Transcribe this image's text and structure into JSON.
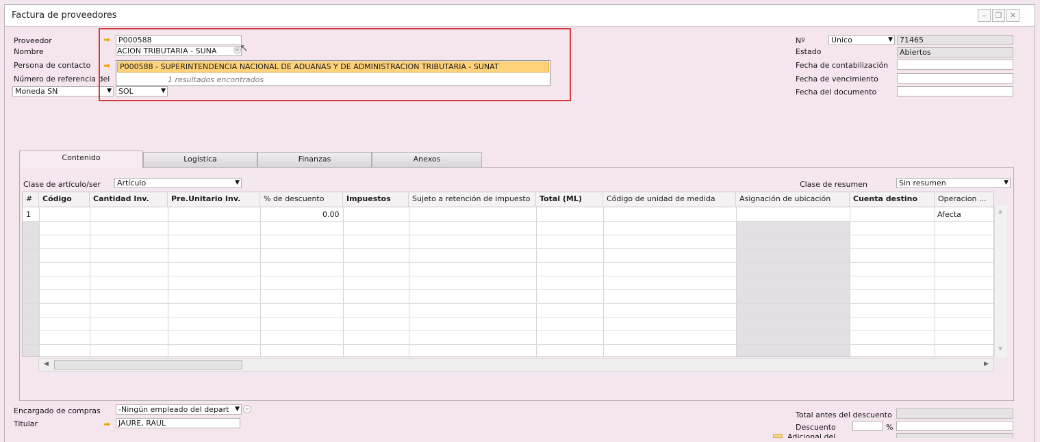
{
  "window": {
    "title": "Factura de proveedores"
  },
  "header": {
    "proveedor_label": "Proveedor",
    "proveedor_value": "P000588",
    "nombre_label": "Nombre",
    "nombre_value": "ACION TRIBUTARIA - SUNA",
    "contacto_label": "Persona de contacto",
    "referencia_label": "Número de referencia del",
    "moneda_label": "Moneda SN",
    "moneda_value": "SOL",
    "suggest_item": "P000588   -  SUPERINTENDENCIA NACIONAL DE ADUANAS Y DE ADMINISTRACION TRIBUTARIA - SUNAT",
    "suggest_info": "1 resultados encontrados",
    "no_label": "Nº",
    "serie_value": "Unico",
    "numero_value": "71465",
    "estado_label": "Estado",
    "estado_value": "Abiertos",
    "fecha_contab_label": "Fecha de contabilización",
    "fecha_venc_label": "Fecha de vencimiento",
    "fecha_doc_label": "Fecha del documento"
  },
  "tabs": [
    "Contenido",
    "Logística",
    "Finanzas",
    "Anexos"
  ],
  "content": {
    "clase_label": "Clase de artículo/ser",
    "clase_value": "Artículo",
    "resumen_label": "Clase de resumen",
    "resumen_value": "Sin resumen"
  },
  "table": {
    "columns": [
      "#",
      "Código",
      "Cantidad Inv.",
      "Pre.Unitario Inv.",
      "% de descuento",
      "Impuestos",
      "Sujeto a retención de impuesto",
      "Total (ML)",
      "Código de unidad de medida",
      "Asignación de ubicación",
      "Cuenta destino",
      "Operacion ..."
    ],
    "row1": {
      "num": "1",
      "descuento": "0.00",
      "operacion": "Afecta"
    }
  },
  "footer": {
    "encargado_label": "Encargado de compras",
    "encargado_value": "-Ningún empleado del depart",
    "titular_label": "Titular",
    "titular_value": "JAURE, RAUL",
    "total_label": "Total antes del descuento",
    "descuento_label": "Descuento",
    "pct": "%",
    "adicional_label": "Adicional del..."
  },
  "colors": {
    "background": "#f3e6ee",
    "highlight": "#ffd27a",
    "annotation": "#d63a3a"
  }
}
